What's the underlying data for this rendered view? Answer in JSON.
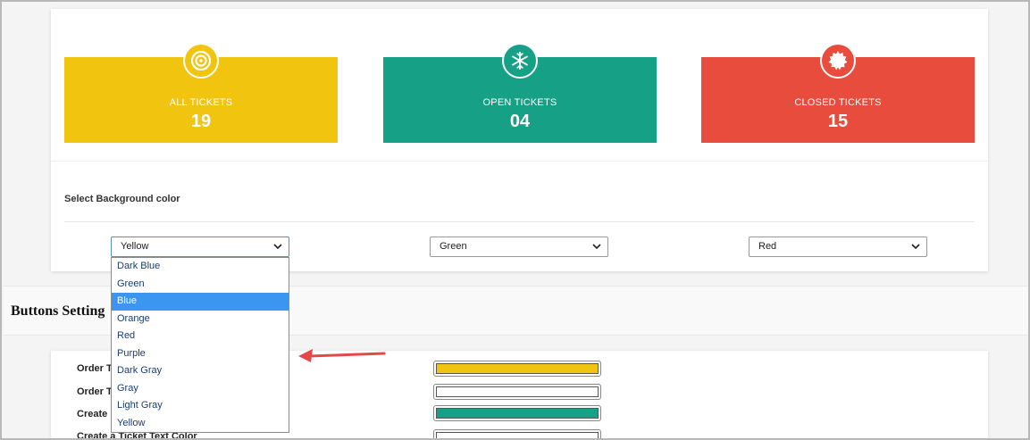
{
  "stats": {
    "all": {
      "label": "ALL TICKETS",
      "value": "19",
      "icon": "target-icon",
      "color": "#f1c40f"
    },
    "open": {
      "label": "OPEN TICKETS",
      "value": "04",
      "icon": "snowflake-icon",
      "color": "#16a085"
    },
    "closed": {
      "label": "CLOSED TICKETS",
      "value": "15",
      "icon": "badge-seal-icon",
      "color": "#e74c3c"
    }
  },
  "background": {
    "section_label": "Select Background color",
    "selects": [
      {
        "value": "Yellow"
      },
      {
        "value": "Green"
      },
      {
        "value": "Red"
      }
    ],
    "options": [
      "Dark Blue",
      "Green",
      "Blue",
      "Orange",
      "Red",
      "Purple",
      "Dark Gray",
      "Gray",
      "Light Gray",
      "Yellow"
    ],
    "highlighted_option": "Blue"
  },
  "buttons_setting": {
    "title": "Buttons Setting",
    "rows": [
      {
        "label": "Order T",
        "swatch_color": "#f1c40f"
      },
      {
        "label": "Order T",
        "swatch_color": "#ffffff"
      },
      {
        "label": "Create",
        "swatch_color": "#16a085"
      },
      {
        "label": "Create a Ticket Text Color",
        "swatch_color": "#ffffff"
      }
    ]
  }
}
